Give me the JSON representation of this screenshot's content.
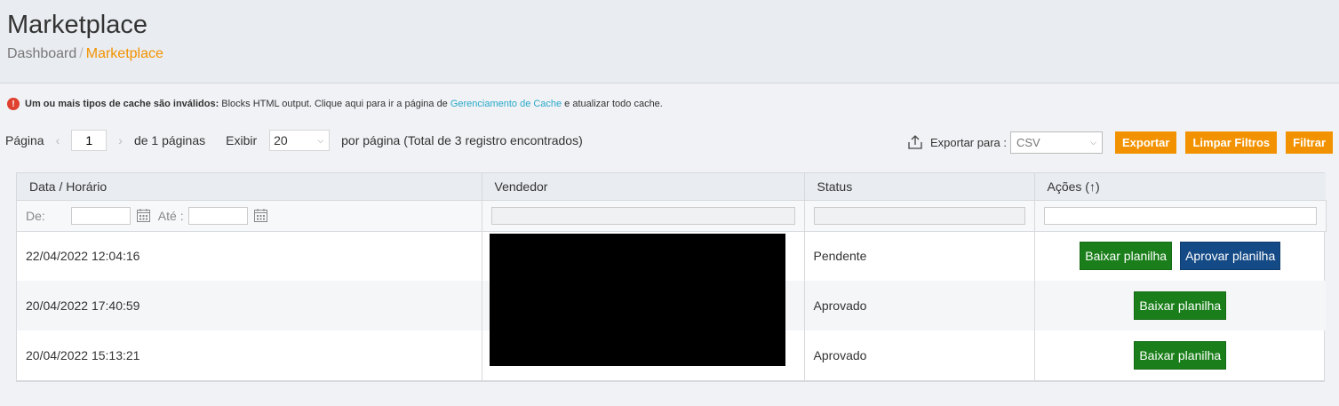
{
  "header": {
    "title": "Marketplace",
    "breadcrumb": [
      "Dashboard",
      "Marketplace"
    ]
  },
  "alert": {
    "icon": "error-icon",
    "bold": "Um ou mais tipos de cache são inválidos:",
    "text_before": "Blocks HTML output. Clique aqui para ir a página de",
    "link": "Gerenciamento de Cache",
    "text_after": "e atualizar todo cache."
  },
  "pager": {
    "page_label": "Página",
    "page_value": "1",
    "of_pages": "de 1 páginas",
    "show_label": "Exibir",
    "per_page": "20",
    "per_page_suffix": "por página (Total de 3 registro encontrados)"
  },
  "export": {
    "label": "Exportar para :",
    "format": "CSV",
    "export_button": "Exportar",
    "clear_button": "Limpar Filtros",
    "filter_button": "Filtrar"
  },
  "table": {
    "columns": [
      "Data / Horário",
      "Vendedor",
      "Status",
      "Ações (↑)"
    ],
    "filters": {
      "from_label": "De:",
      "to_label": "Até :"
    },
    "rows": [
      {
        "datetime": "22/04/2022 12:04:16",
        "status": "Pendente",
        "actions": [
          "Baixar planilha",
          "Aprovar planilha"
        ]
      },
      {
        "datetime": "20/04/2022 17:40:59",
        "status": "Aprovado",
        "actions": [
          "Baixar planilha"
        ]
      },
      {
        "datetime": "20/04/2022 15:13:21",
        "status": "Aprovado",
        "actions": [
          "Baixar planilha"
        ]
      }
    ]
  },
  "colors": {
    "accent_orange": "#f39200",
    "download_green": "#1a7f1a",
    "approve_blue": "#144a86",
    "link_teal": "#2aa9c9"
  }
}
